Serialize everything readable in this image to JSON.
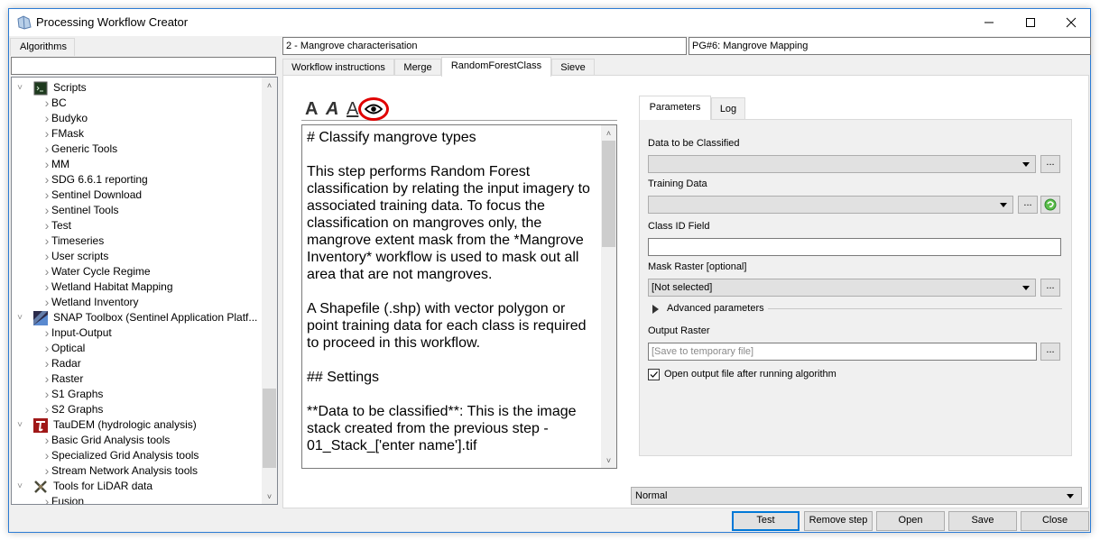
{
  "window": {
    "title": "Processing Workflow Creator",
    "controls": [
      "minimize",
      "maximize",
      "close"
    ]
  },
  "left_panel": {
    "tab_label": "Algorithms",
    "search_value": "",
    "tree": [
      {
        "type": "group",
        "label": "Scripts",
        "icon": "terminal-icon",
        "expanded": true
      },
      {
        "type": "item",
        "label": "BC"
      },
      {
        "type": "item",
        "label": "Budyko"
      },
      {
        "type": "item",
        "label": "FMask"
      },
      {
        "type": "item",
        "label": "Generic Tools"
      },
      {
        "type": "item",
        "label": "MM"
      },
      {
        "type": "item",
        "label": "SDG 6.6.1 reporting"
      },
      {
        "type": "item",
        "label": "Sentinel Download"
      },
      {
        "type": "item",
        "label": "Sentinel Tools"
      },
      {
        "type": "item",
        "label": "Test"
      },
      {
        "type": "item",
        "label": "Timeseries"
      },
      {
        "type": "item",
        "label": "User scripts"
      },
      {
        "type": "item",
        "label": "Water Cycle Regime"
      },
      {
        "type": "item",
        "label": "Wetland Habitat Mapping"
      },
      {
        "type": "item",
        "label": "Wetland Inventory"
      },
      {
        "type": "group",
        "label": "SNAP Toolbox (Sentinel Application Platf...",
        "icon": "snap-icon",
        "expanded": true
      },
      {
        "type": "item",
        "label": "Input-Output"
      },
      {
        "type": "item",
        "label": "Optical"
      },
      {
        "type": "item",
        "label": "Radar"
      },
      {
        "type": "item",
        "label": "Raster"
      },
      {
        "type": "item",
        "label": "S1 Graphs"
      },
      {
        "type": "item",
        "label": "S2 Graphs"
      },
      {
        "type": "group",
        "label": "TauDEM (hydrologic analysis)",
        "icon": "taudem-icon",
        "expanded": true
      },
      {
        "type": "item",
        "label": "Basic Grid Analysis tools"
      },
      {
        "type": "item",
        "label": "Specialized Grid Analysis tools"
      },
      {
        "type": "item",
        "label": "Stream Network Analysis tools"
      },
      {
        "type": "group",
        "label": "Tools for LiDAR data",
        "icon": "satellite-icon",
        "expanded": true
      },
      {
        "type": "item",
        "label": "Fusion"
      }
    ]
  },
  "header": {
    "step_name": "2 - Mangrove characterisation",
    "workflow_name": "PG#6: Mangrove Mapping"
  },
  "tabs": [
    {
      "label": "Workflow instructions",
      "active": false
    },
    {
      "label": "Merge",
      "active": false
    },
    {
      "label": "RandomForestClass",
      "active": true
    },
    {
      "label": "Sieve",
      "active": false
    }
  ],
  "editor": {
    "toolbar": {
      "bold": "A",
      "italic": "A",
      "underline": "A",
      "preview_icon": "eye-icon",
      "highlight_color": "#e00000"
    },
    "text": "# Classify mangrove types\n\nThis step performs Random Forest classification by relating the input imagery to associated training data. To focus the classification on mangroves only, the mangrove extent mask from the *Mangrove Inventory* workflow is used to mask out all area that are not mangroves.\n\nA Shapefile (.shp) with vector polygon or point training data for each class is required to proceed in this workflow.\n\n## Settings\n\n**Data to be classified**: This is the image stack created from the previous step - 01_Stack_['enter name'].tif"
  },
  "params": {
    "tabs": [
      {
        "label": "Parameters",
        "active": true
      },
      {
        "label": "Log",
        "active": false
      }
    ],
    "data_to_classify": {
      "label": "Data to be Classified",
      "value": ""
    },
    "training_data": {
      "label": "Training Data",
      "value": ""
    },
    "class_id_field": {
      "label": "Class ID Field",
      "value": ""
    },
    "mask_raster": {
      "label": "Mask Raster [optional]",
      "value": "[Not selected]"
    },
    "advanced_label": "Advanced parameters",
    "output_raster": {
      "label": "Output Raster",
      "placeholder": "[Save to temporary file]"
    },
    "open_output": {
      "label": "Open output file after running algorithm",
      "checked": true
    },
    "browse_label": "..."
  },
  "mode": {
    "value": "Normal"
  },
  "buttons": {
    "test": "Test",
    "remove_step": "Remove step",
    "open": "Open",
    "save": "Save",
    "close": "Close"
  },
  "colors": {
    "accent": "#0078d7",
    "window_border": "#2b7bd4",
    "refresh_green": "#3aa040",
    "taudem_red": "#a01818"
  }
}
